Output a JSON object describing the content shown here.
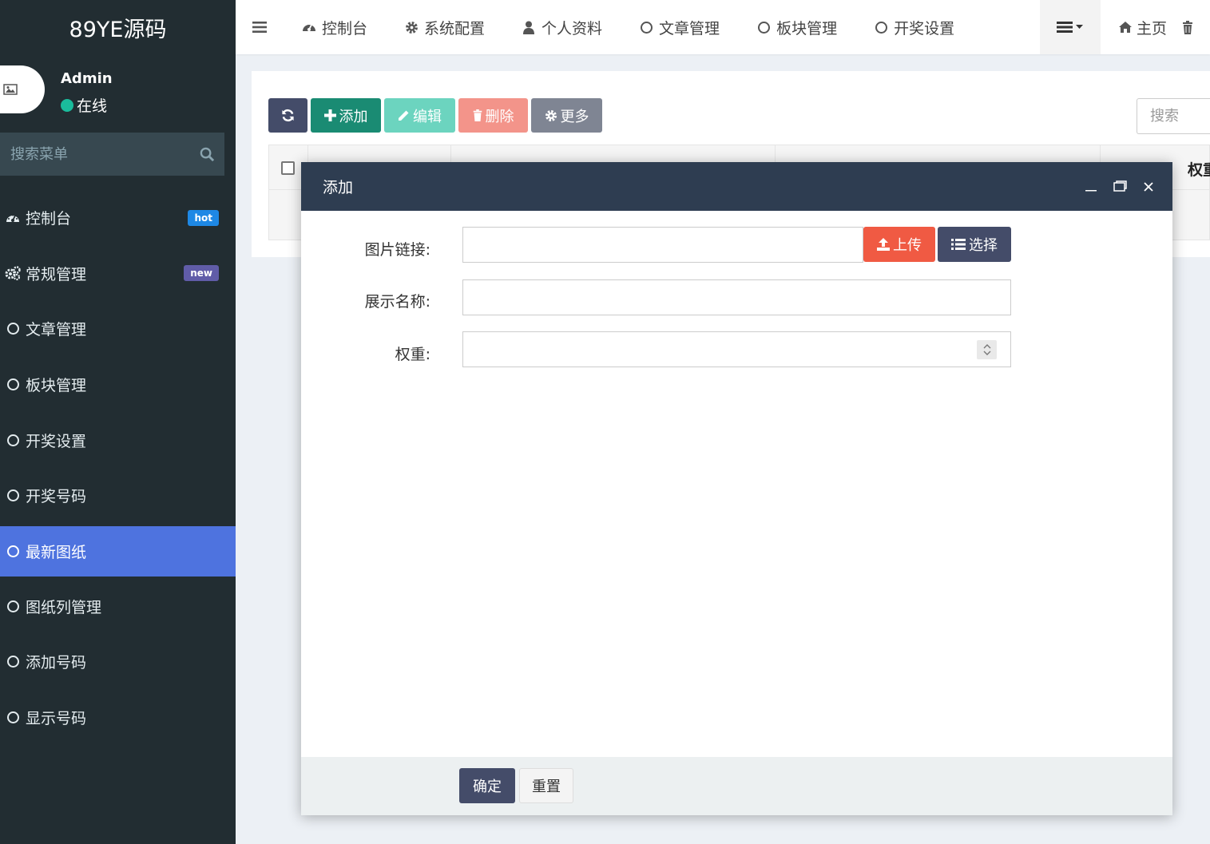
{
  "app": {
    "logo": "89YE源码"
  },
  "user": {
    "name": "Admin",
    "status": "在线"
  },
  "sidebar": {
    "search_placeholder": "搜索菜单",
    "items": [
      {
        "label": "控制台",
        "icon": "dashboard-icon",
        "badge": "hot"
      },
      {
        "label": "常规管理",
        "icon": "cogs-icon",
        "badge": "new"
      },
      {
        "label": "文章管理",
        "icon": "circle-icon"
      },
      {
        "label": "板块管理",
        "icon": "circle-icon"
      },
      {
        "label": "开奖设置",
        "icon": "circle-icon"
      },
      {
        "label": "开奖号码",
        "icon": "circle-icon"
      },
      {
        "label": "最新图纸",
        "icon": "circle-icon",
        "active": true
      },
      {
        "label": "图纸列管理",
        "icon": "circle-icon"
      },
      {
        "label": "添加号码",
        "icon": "circle-icon"
      },
      {
        "label": "显示号码",
        "icon": "circle-icon"
      }
    ]
  },
  "topnav": {
    "tabs": [
      {
        "label": "控制台",
        "icon": "dashboard-icon"
      },
      {
        "label": "系统配置",
        "icon": "gear-icon"
      },
      {
        "label": "个人资料",
        "icon": "user-icon"
      },
      {
        "label": "文章管理",
        "icon": "circle-icon"
      },
      {
        "label": "板块管理",
        "icon": "circle-icon"
      },
      {
        "label": "开奖设置",
        "icon": "circle-icon"
      }
    ],
    "home_label": "主页"
  },
  "toolbar": {
    "add_label": "添加",
    "edit_label": "编辑",
    "delete_label": "删除",
    "more_label": "更多",
    "search_placeholder": "搜索"
  },
  "table": {
    "visible_header": "权重"
  },
  "modal": {
    "title": "添加",
    "fields": {
      "image_link_label": "图片链接:",
      "display_name_label": "展示名称:",
      "weight_label": "权重:"
    },
    "upload_label": "上传",
    "select_label": "选择",
    "confirm_label": "确定",
    "reset_label": "重置"
  },
  "colors": {
    "sidebar_bg": "#222d32",
    "active_item": "#4e73df",
    "modal_header": "#2e3d51",
    "primary_dark": "#444c69",
    "success": "#1a8b73",
    "danger": "#f05a43",
    "online_dot": "#1abc9c"
  }
}
